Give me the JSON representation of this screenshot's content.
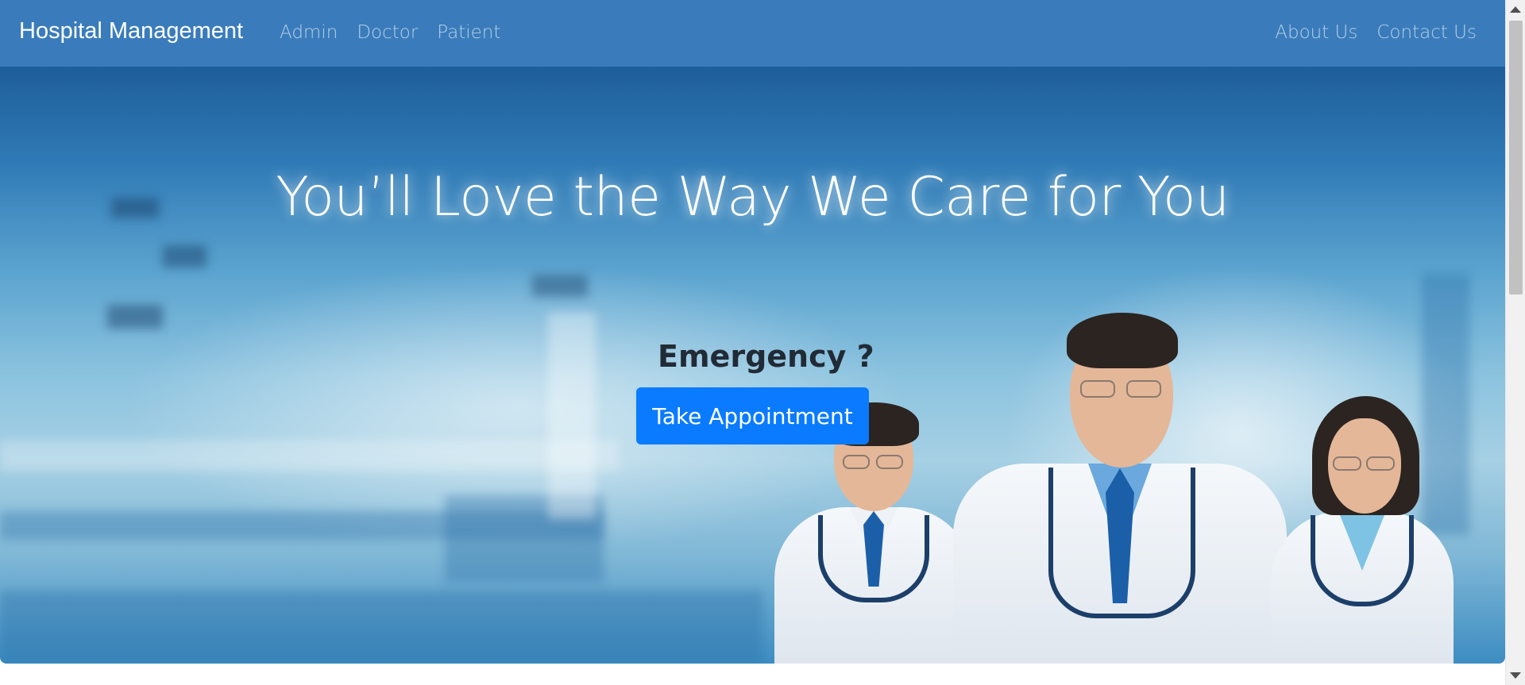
{
  "navbar": {
    "brand": "Hospital Management",
    "left_links": [
      "Admin",
      "Doctor",
      "Patient"
    ],
    "right_links": [
      "About Us",
      "Contact Us"
    ]
  },
  "hero": {
    "title": "You’ll Love the Way We Care for You",
    "emergency_label": "Emergency ?",
    "appointment_button": "Take Appointment"
  },
  "colors": {
    "navbar": "#3a7cbb",
    "button": "#0a7bff",
    "emergency_text": "#212b36"
  },
  "icons": [
    "doctors-photo"
  ]
}
